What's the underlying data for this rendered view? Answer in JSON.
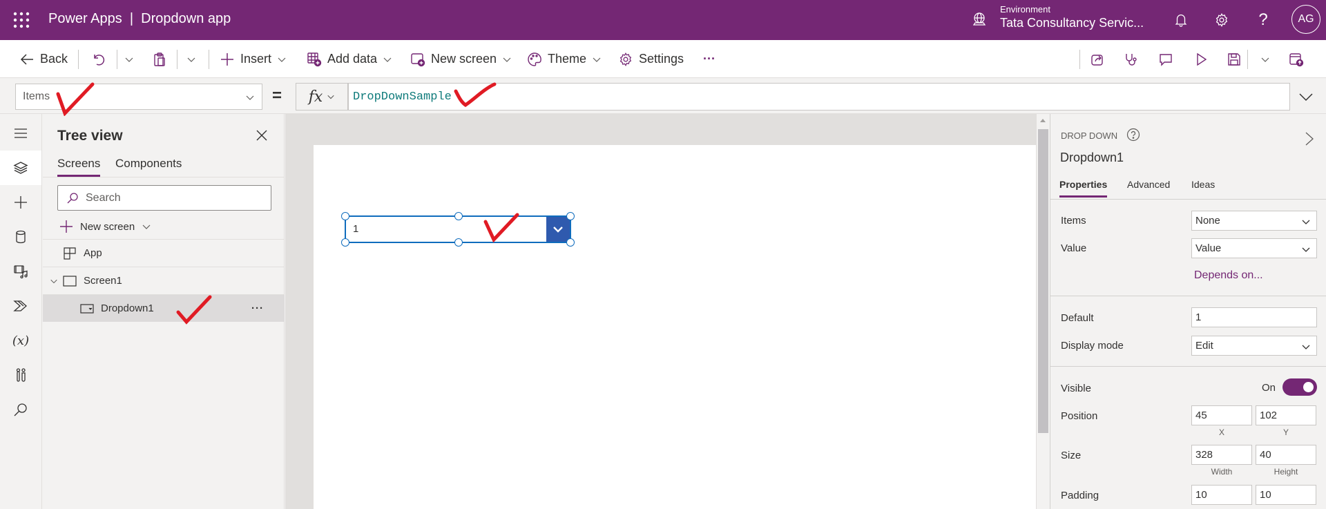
{
  "header": {
    "app_title": "Power Apps  |  Dropdown app",
    "environment_label": "Environment",
    "environment_name": "Tata Consultancy Servic...",
    "avatar_initials": "AG",
    "brand_color": "#742774"
  },
  "toolbar": {
    "back": "Back",
    "insert": "Insert",
    "add_data": "Add data",
    "new_screen": "New screen",
    "theme": "Theme",
    "settings": "Settings",
    "more": "···"
  },
  "formula_bar": {
    "property": "Items",
    "equals": "=",
    "fx": "fx",
    "formula": "DropDownSample"
  },
  "tree_view": {
    "title": "Tree view",
    "tabs": [
      "Screens",
      "Components"
    ],
    "active_tab": "Screens",
    "search_placeholder": "Search",
    "new_screen": "New screen",
    "items": [
      {
        "label": "App",
        "type": "app"
      },
      {
        "label": "Screen1",
        "type": "screen",
        "expanded": true
      },
      {
        "label": "Dropdown1",
        "type": "dropdown",
        "selected": true,
        "more": "···"
      }
    ]
  },
  "canvas": {
    "dropdown_value": "1"
  },
  "properties": {
    "control_type": "DROP DOWN",
    "control_name": "Dropdown1",
    "tabs": [
      "Properties",
      "Advanced",
      "Ideas"
    ],
    "active_tab": "Properties",
    "items_label": "Items",
    "items_value": "None",
    "value_label": "Value",
    "value_value": "Value",
    "depends_on": "Depends on...",
    "default_label": "Default",
    "default_value": "1",
    "display_mode_label": "Display mode",
    "display_mode_value": "Edit",
    "visible_label": "Visible",
    "visible_state": "On",
    "position_label": "Position",
    "position_x": "45",
    "position_y": "102",
    "x_caption": "X",
    "y_caption": "Y",
    "size_label": "Size",
    "size_width": "328",
    "size_height": "40",
    "width_caption": "Width",
    "height_caption": "Height",
    "padding_label": "Padding",
    "padding_1": "10",
    "padding_2": "10"
  }
}
